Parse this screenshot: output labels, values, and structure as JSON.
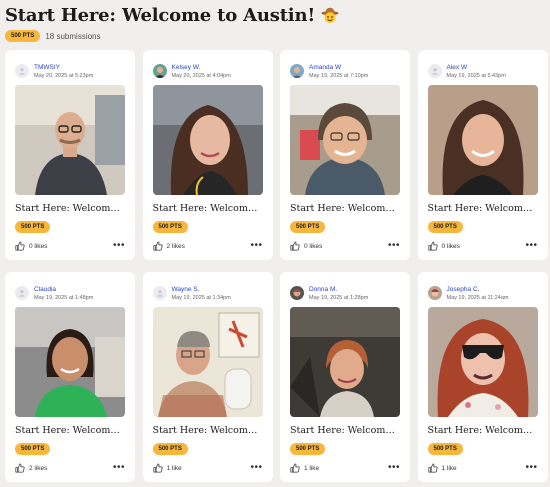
{
  "page": {
    "title": "Start Here: Welcome to Austin!",
    "title_icon": "cowboy-hat-face-emoji",
    "points": "500 PTS",
    "submissions": "18 submissions"
  },
  "colors": {
    "accent_badge": "#f6b73c",
    "name_link": "#2a44c9",
    "background": "#f1eeee"
  },
  "cards": [
    {
      "name": "TMWSIY",
      "date": "May 20, 2025 at 5:23pm",
      "avatar": "default",
      "title": "Start Here: Welcome t...",
      "points": "500 PTS",
      "likes": "0 likes",
      "photo": "man-glasses-office"
    },
    {
      "name": "Kelsey W.",
      "date": "May 20, 2025 at 4:04pm",
      "avatar": "photo",
      "title": "Start Here: Welcome t...",
      "points": "500 PTS",
      "likes": "2 likes",
      "photo": "woman-brown-hair-airport"
    },
    {
      "name": "Amanda W",
      "date": "May 19, 2025 at 7:10pm",
      "avatar": "photo",
      "title": "Start Here: Welcome t...",
      "points": "500 PTS",
      "likes": "0 likes",
      "photo": "woman-short-hair-glasses"
    },
    {
      "name": "Alex W",
      "date": "May 19, 2025 at 5:43pm",
      "avatar": "default",
      "title": "Start Here: Welcome t...",
      "points": "500 PTS",
      "likes": "0 likes",
      "photo": "woman-smiling-indoors"
    },
    {
      "name": "Claudia",
      "date": "May 19, 2025 at 1:48pm",
      "avatar": "default",
      "title": "Start Here: Welcome t...",
      "points": "500 PTS",
      "likes": "2 likes",
      "photo": "woman-green-top"
    },
    {
      "name": "Wayne S.",
      "date": "May 19, 2025 at 1:34pm",
      "avatar": "default",
      "title": "Start Here: Welcome t...",
      "points": "500 PTS",
      "likes": "1 like",
      "photo": "man-plaid-shirt-lobster-art"
    },
    {
      "name": "Donna M.",
      "date": "May 19, 2025 at 1:28pm",
      "avatar": "photo",
      "title": "Start Here: Welcome t...",
      "points": "500 PTS",
      "likes": "1 like",
      "photo": "woman-car-selfie"
    },
    {
      "name": "Josepha C.",
      "date": "May 19, 2025 at 11:24am",
      "avatar": "photo",
      "title": "Start Here: Welcome t...",
      "points": "500 PTS",
      "likes": "1 like",
      "photo": "woman-sunglasses-red-hair"
    }
  ]
}
